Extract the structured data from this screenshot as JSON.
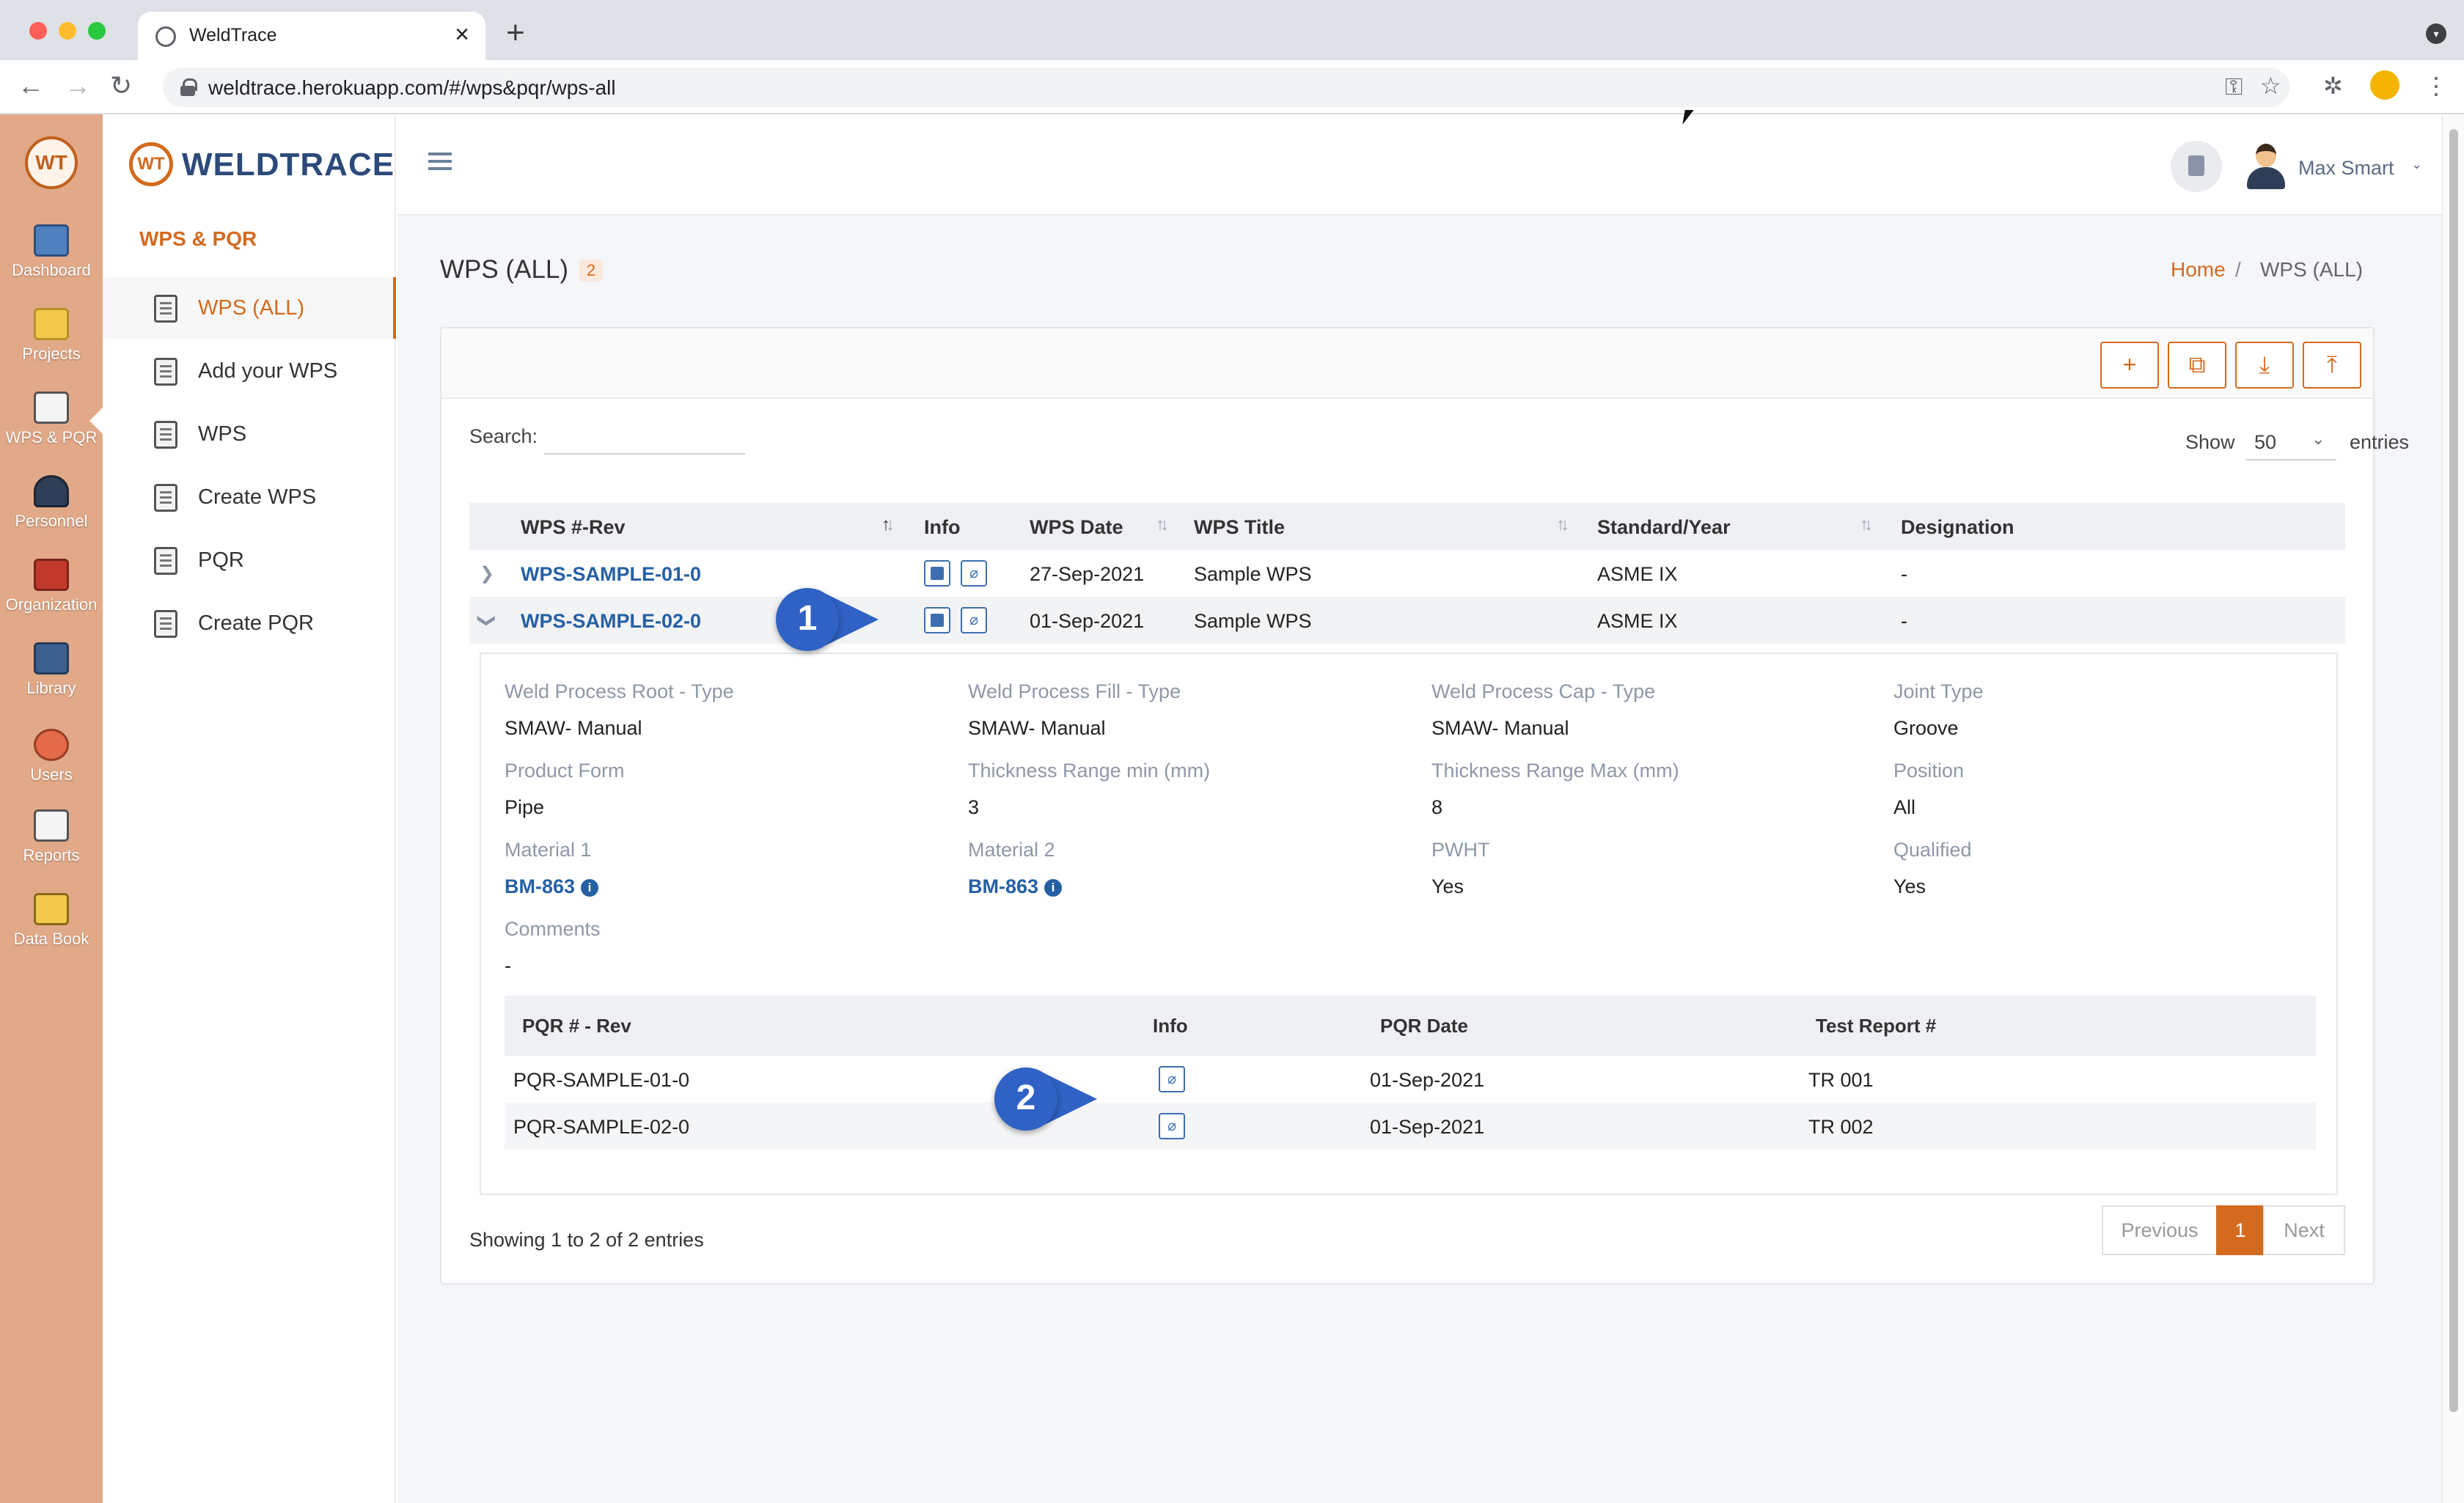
{
  "browser": {
    "tab_title": "WeldTrace",
    "url": "weldtrace.herokuapp.com/#/wps&pqr/wps-all",
    "colors": {
      "close": "#ff5f57",
      "minimize": "#febc2e",
      "zoom": "#28c840"
    }
  },
  "rail": {
    "items": [
      {
        "label": "Dashboard",
        "icon": "dashboard-icon"
      },
      {
        "label": "Projects",
        "icon": "projects-icon"
      },
      {
        "label": "WPS & PQR",
        "icon": "wps-pqr-icon"
      },
      {
        "label": "Personnel",
        "icon": "personnel-icon"
      },
      {
        "label": "Organization",
        "icon": "organization-icon"
      },
      {
        "label": "Library",
        "icon": "library-icon"
      },
      {
        "label": "Users",
        "icon": "users-icon"
      },
      {
        "label": "Reports",
        "icon": "reports-icon"
      },
      {
        "label": "Data Book",
        "icon": "data-book-icon"
      }
    ]
  },
  "sidebar": {
    "brand": "WELDTRACE",
    "brand_mark": "WT",
    "section": "WPS & PQR",
    "items": [
      {
        "label": "WPS (ALL)",
        "active": true
      },
      {
        "label": "Add your WPS"
      },
      {
        "label": "WPS"
      },
      {
        "label": "Create WPS"
      },
      {
        "label": "PQR"
      },
      {
        "label": "Create PQR"
      }
    ]
  },
  "header": {
    "user_name": "Max Smart"
  },
  "page": {
    "title": "WPS (ALL)",
    "count": "2",
    "breadcrumb": {
      "home": "Home",
      "separator": "/",
      "current": "WPS (ALL)"
    }
  },
  "table": {
    "search_label": "Search:",
    "search_value": "",
    "show_label": "Show",
    "show_value": "50",
    "entries_label": "entries",
    "columns": [
      "WPS #-Rev",
      "Info",
      "WPS Date",
      "WPS Title",
      "Standard/Year",
      "Designation"
    ],
    "rows": [
      {
        "wps": "WPS-SAMPLE-01-0",
        "date": "27-Sep-2021",
        "title": "Sample WPS",
        "standard": "ASME IX",
        "designation": "-"
      },
      {
        "wps": "WPS-SAMPLE-02-0",
        "date": "01-Sep-2021",
        "title": "Sample WPS",
        "standard": "ASME IX",
        "designation": "-"
      }
    ],
    "showing": "Showing 1 to 2 of 2 entries",
    "pagination": {
      "previous": "Previous",
      "current": "1",
      "next": "Next"
    }
  },
  "detail": {
    "fields": [
      {
        "label": "Weld Process Root - Type",
        "value": "SMAW- Manual"
      },
      {
        "label": "Weld Process Fill - Type",
        "value": "SMAW- Manual"
      },
      {
        "label": "Weld Process Cap - Type",
        "value": "SMAW- Manual"
      },
      {
        "label": "Joint Type",
        "value": "Groove"
      },
      {
        "label": "Product Form",
        "value": "Pipe"
      },
      {
        "label": "Thickness Range min (mm)",
        "value": "3"
      },
      {
        "label": "Thickness Range Max (mm)",
        "value": "8"
      },
      {
        "label": "Position",
        "value": "All"
      },
      {
        "label": "Material 1",
        "value": "BM-863"
      },
      {
        "label": "Material 2",
        "value": "BM-863"
      },
      {
        "label": "PWHT",
        "value": "Yes"
      },
      {
        "label": "Qualified",
        "value": "Yes"
      },
      {
        "label": "Comments",
        "value": "-"
      }
    ],
    "pqr_columns": [
      "PQR # - Rev",
      "Info",
      "PQR Date",
      "Test Report #"
    ],
    "pqr_rows": [
      {
        "pqr": "PQR-SAMPLE-01-0",
        "date": "01-Sep-2021",
        "report": "TR 001"
      },
      {
        "pqr": "PQR-SAMPLE-02-0",
        "date": "01-Sep-2021",
        "report": "TR 002"
      }
    ]
  },
  "callouts": [
    "1",
    "2"
  ],
  "colors": {
    "accent": "#d46a1e",
    "link": "#2660a4",
    "rail": "#e2a988",
    "callout": "#2f62c4"
  }
}
